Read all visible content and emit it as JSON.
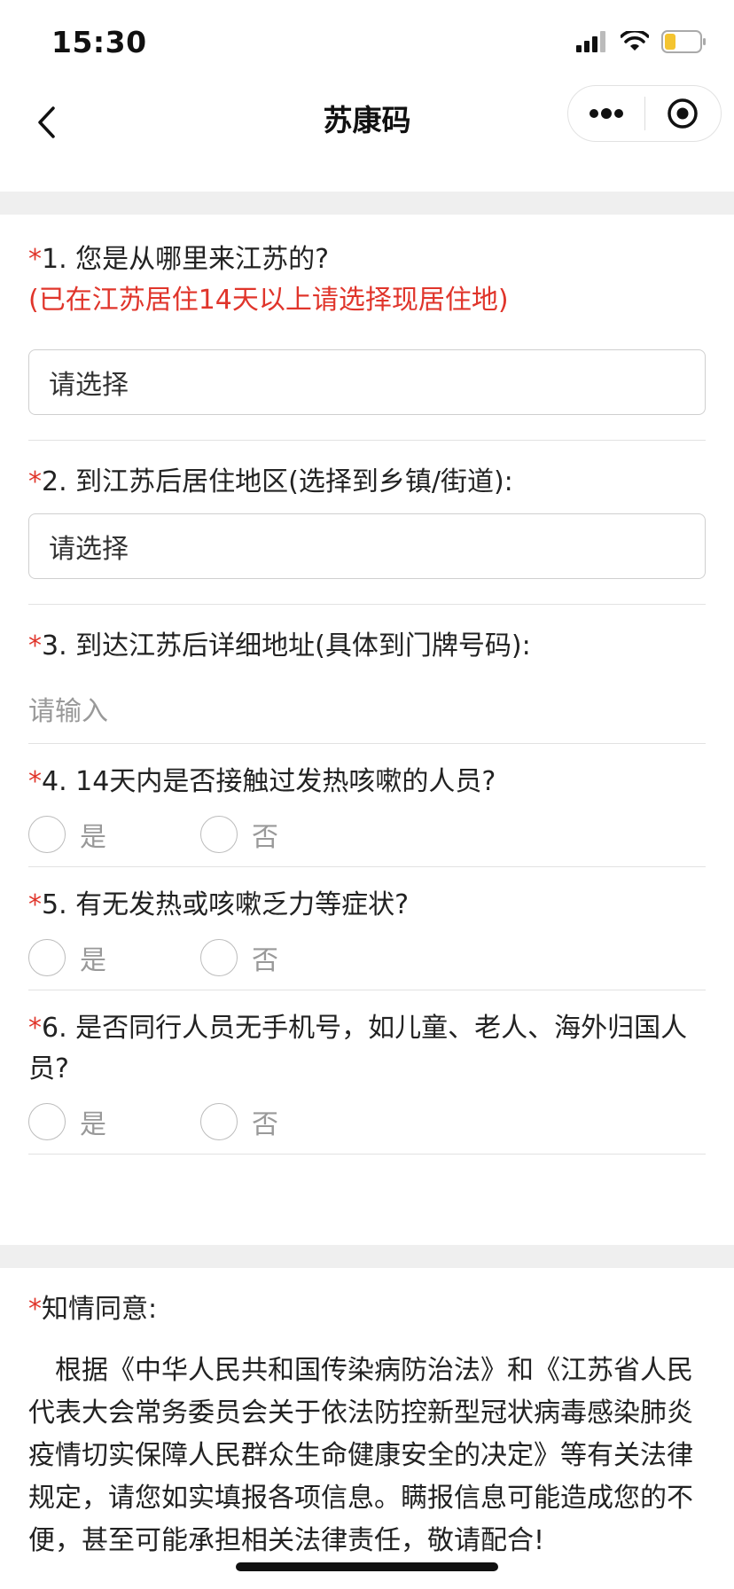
{
  "status": {
    "time": "15:30"
  },
  "nav": {
    "title": "苏康码"
  },
  "questions": {
    "q1": {
      "asterisk": "*",
      "label": "1. 您是从哪里来江苏的?",
      "note": "(已在江苏居住14天以上请选择现居住地)",
      "select_value": "请选择"
    },
    "q2": {
      "asterisk": "*",
      "label": "2. 到江苏后居住地区(选择到乡镇/街道):",
      "select_value": "请选择"
    },
    "q3": {
      "asterisk": "*",
      "label": "3. 到达江苏后详细地址(具体到门牌号码):",
      "placeholder": "请输入"
    },
    "q4": {
      "asterisk": "*",
      "label": "4. 14天内是否接触过发热咳嗽的人员?",
      "yes": "是",
      "no": "否"
    },
    "q5": {
      "asterisk": "*",
      "label": "5. 有无发热或咳嗽乏力等症状?",
      "yes": "是",
      "no": "否"
    },
    "q6": {
      "asterisk": "*",
      "label": "6. 是否同行人员无手机号，如儿童、老人、海外归国人员?",
      "yes": "是",
      "no": "否"
    }
  },
  "consent": {
    "asterisk": "*",
    "title": "知情同意:",
    "body": "根据《中华人民共和国传染病防治法》和《江苏省人民代表大会常务委员会关于依法防控新型冠状病毒感染肺炎疫情切实保障人民群众生命健康安全的决定》等有关法律规定，请您如实填报各项信息。瞒报信息可能造成您的不便，甚至可能承担相关法律责任，敬请配合!"
  },
  "colors": {
    "required": "#e0352b",
    "band": "#efefef",
    "divider": "#e2e2e2"
  },
  "icons": [
    "signal-icon",
    "wifi-icon",
    "battery-icon",
    "back-arrow-icon",
    "more-dots-icon",
    "close-mini-program-icon"
  ]
}
